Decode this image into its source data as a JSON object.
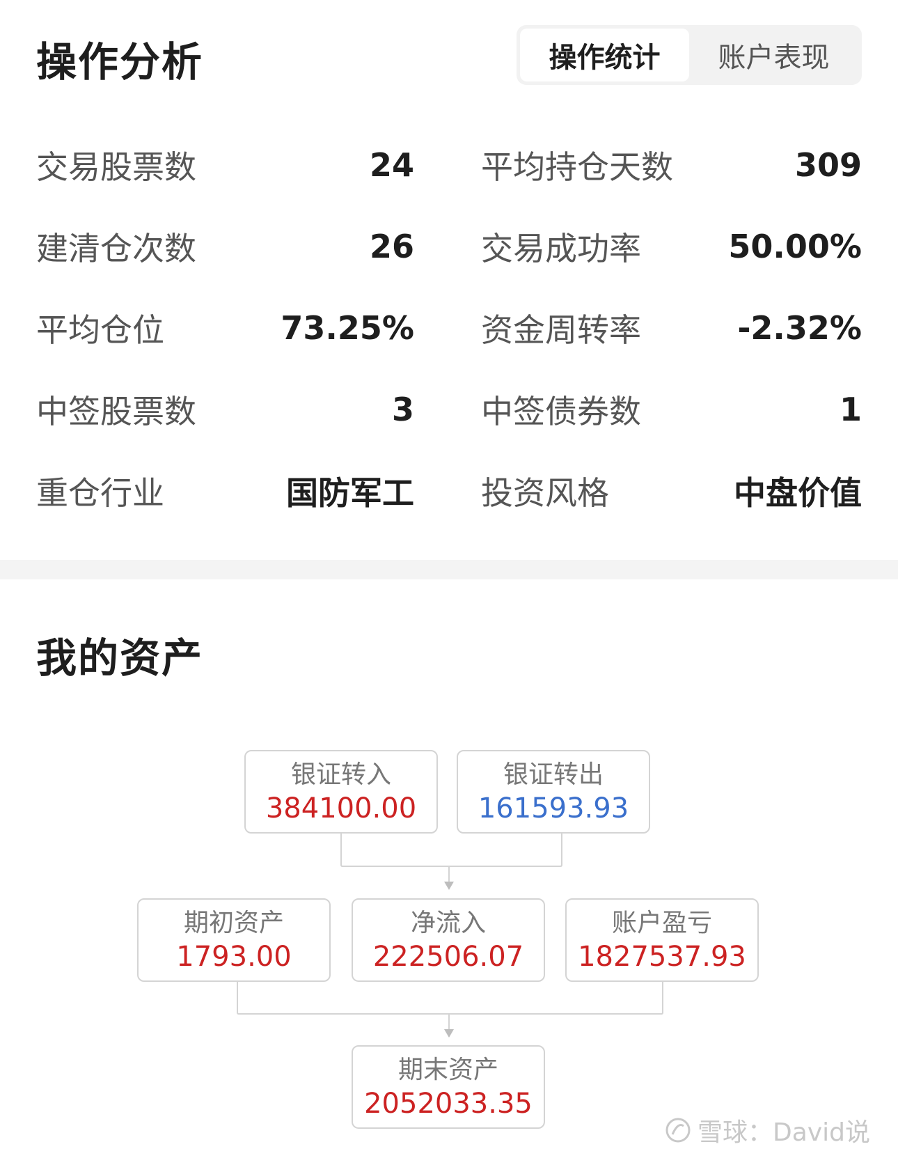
{
  "ops": {
    "title": "操作分析",
    "tabs": [
      {
        "label": "操作统计",
        "active": true
      },
      {
        "label": "账户表现",
        "active": false
      }
    ],
    "stats": [
      {
        "left_label": "交易股票数",
        "left_value": "24",
        "right_label": "平均持仓天数",
        "right_value": "309"
      },
      {
        "left_label": "建清仓次数",
        "left_value": "26",
        "right_label": "交易成功率",
        "right_value": "50.00%"
      },
      {
        "left_label": "平均仓位",
        "left_value": "73.25%",
        "right_label": "资金周转率",
        "right_value": "-2.32%"
      },
      {
        "left_label": "中签股票数",
        "left_value": "3",
        "right_label": "中签债券数",
        "right_value": "1"
      },
      {
        "left_label": "重仓行业",
        "left_value": "国防军工",
        "right_label": "投资风格",
        "right_value": "中盘价值"
      }
    ]
  },
  "assets": {
    "title": "我的资产",
    "bank_in": {
      "label": "银证转入",
      "value": "384100.00"
    },
    "bank_out": {
      "label": "银证转出",
      "value": "161593.93"
    },
    "begin": {
      "label": "期初资产",
      "value": "1793.00"
    },
    "net_inflow": {
      "label": "净流入",
      "value": "222506.07"
    },
    "pnl": {
      "label": "账户盈亏",
      "value": "1827537.93"
    },
    "end": {
      "label": "期末资产",
      "value": "2052033.35"
    }
  },
  "colors": {
    "positive": "#cc2222",
    "negative": "#3a6fcc"
  },
  "watermark": {
    "text": "雪球：David说",
    "icon": "snowball-logo-icon"
  }
}
